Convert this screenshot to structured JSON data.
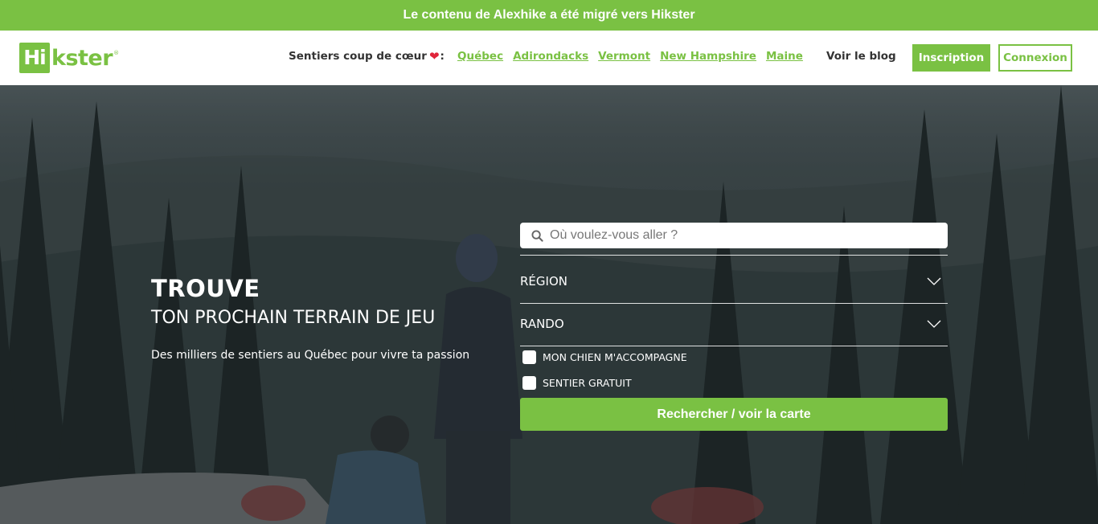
{
  "banner": {
    "text": "Le contenu de Alexhike a été migré vers Hikster"
  },
  "header": {
    "logo": {
      "box_text": "Hi",
      "text": "kster",
      "tm": "®"
    },
    "favorites_label": "Sentiers coup de cœur",
    "favorites_icon": "heart-icon",
    "favorites_colon": ":",
    "regions": [
      "Québec",
      "Adirondacks",
      "Vermont",
      "New Hampshire",
      "Maine"
    ],
    "blog_label": "Voir le blog",
    "signup_label": "Inscription",
    "login_label": "Connexion"
  },
  "hero": {
    "title": "TROUVE",
    "subtitle": "TON PROCHAIN TERRAIN DE JEU",
    "tagline": "Des milliers de sentiers au Québec pour vivre ta passion"
  },
  "search": {
    "placeholder": "Où voulez-vous aller ?",
    "search_icon": "search-icon",
    "region_label": "RÉGION",
    "activity_label": "RANDO",
    "dropdown_icon": "chevron-down-icon",
    "dog_label": "MON CHIEN M'ACCOMPAGNE",
    "free_label": "SENTIER GRATUIT",
    "submit_label": "Rechercher / voir la carte"
  },
  "colors": {
    "brand_green": "#7ac143",
    "heart_red": "#e0243a",
    "text_dark": "#333333"
  }
}
